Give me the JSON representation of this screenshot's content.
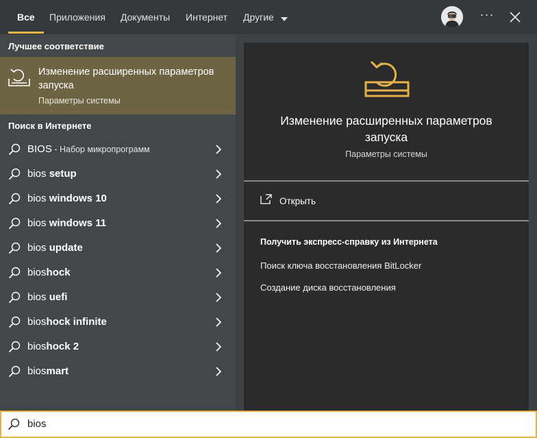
{
  "tabs": [
    {
      "label": "Все"
    },
    {
      "label": "Приложения"
    },
    {
      "label": "Документы"
    },
    {
      "label": "Интернет"
    },
    {
      "label": "Другие"
    }
  ],
  "icons": {
    "avatar": "user-avatar",
    "more": "more-horizontal-icon",
    "close": "close-icon",
    "search": "search-icon",
    "chevron": "chevron-right-icon",
    "startup": "advanced-startup-icon",
    "open": "open-icon"
  },
  "colors": {
    "accent": "#e5b34a",
    "selected": "#6c6442",
    "panel": "#2b2b2b",
    "list_bg": "#444749"
  },
  "more_label": "···",
  "left": {
    "best_match_header": "Лучшее соответствие",
    "best_match": {
      "title": "Изменение расширенных параметров запуска",
      "subtitle": "Параметры системы"
    },
    "web_header": "Поиск в Интернете",
    "results": [
      {
        "prefix": "BIOS",
        "bold": "",
        "extra": " - Набор микропрограмм"
      },
      {
        "prefix": "bios ",
        "bold": "setup",
        "extra": ""
      },
      {
        "prefix": "bios ",
        "bold": "windows 10",
        "extra": ""
      },
      {
        "prefix": "bios ",
        "bold": "windows 11",
        "extra": ""
      },
      {
        "prefix": "bios ",
        "bold": "update",
        "extra": ""
      },
      {
        "prefix": "bios",
        "bold": "hock",
        "extra": ""
      },
      {
        "prefix": "bios ",
        "bold": "uefi",
        "extra": ""
      },
      {
        "prefix": "bios",
        "bold": "hock infinite",
        "extra": ""
      },
      {
        "prefix": "bios",
        "bold": "hock 2",
        "extra": ""
      },
      {
        "prefix": "bios",
        "bold": "mart",
        "extra": ""
      }
    ]
  },
  "right": {
    "title": "Изменение расширенных параметров запуска",
    "subtitle": "Параметры системы",
    "open_label": "Открыть",
    "help_header": "Получить экспресс-справку из Интернета",
    "help_links": [
      "Поиск ключа восстановления BitLocker",
      "Создание диска восстановления"
    ]
  },
  "search": {
    "value": "bios"
  }
}
